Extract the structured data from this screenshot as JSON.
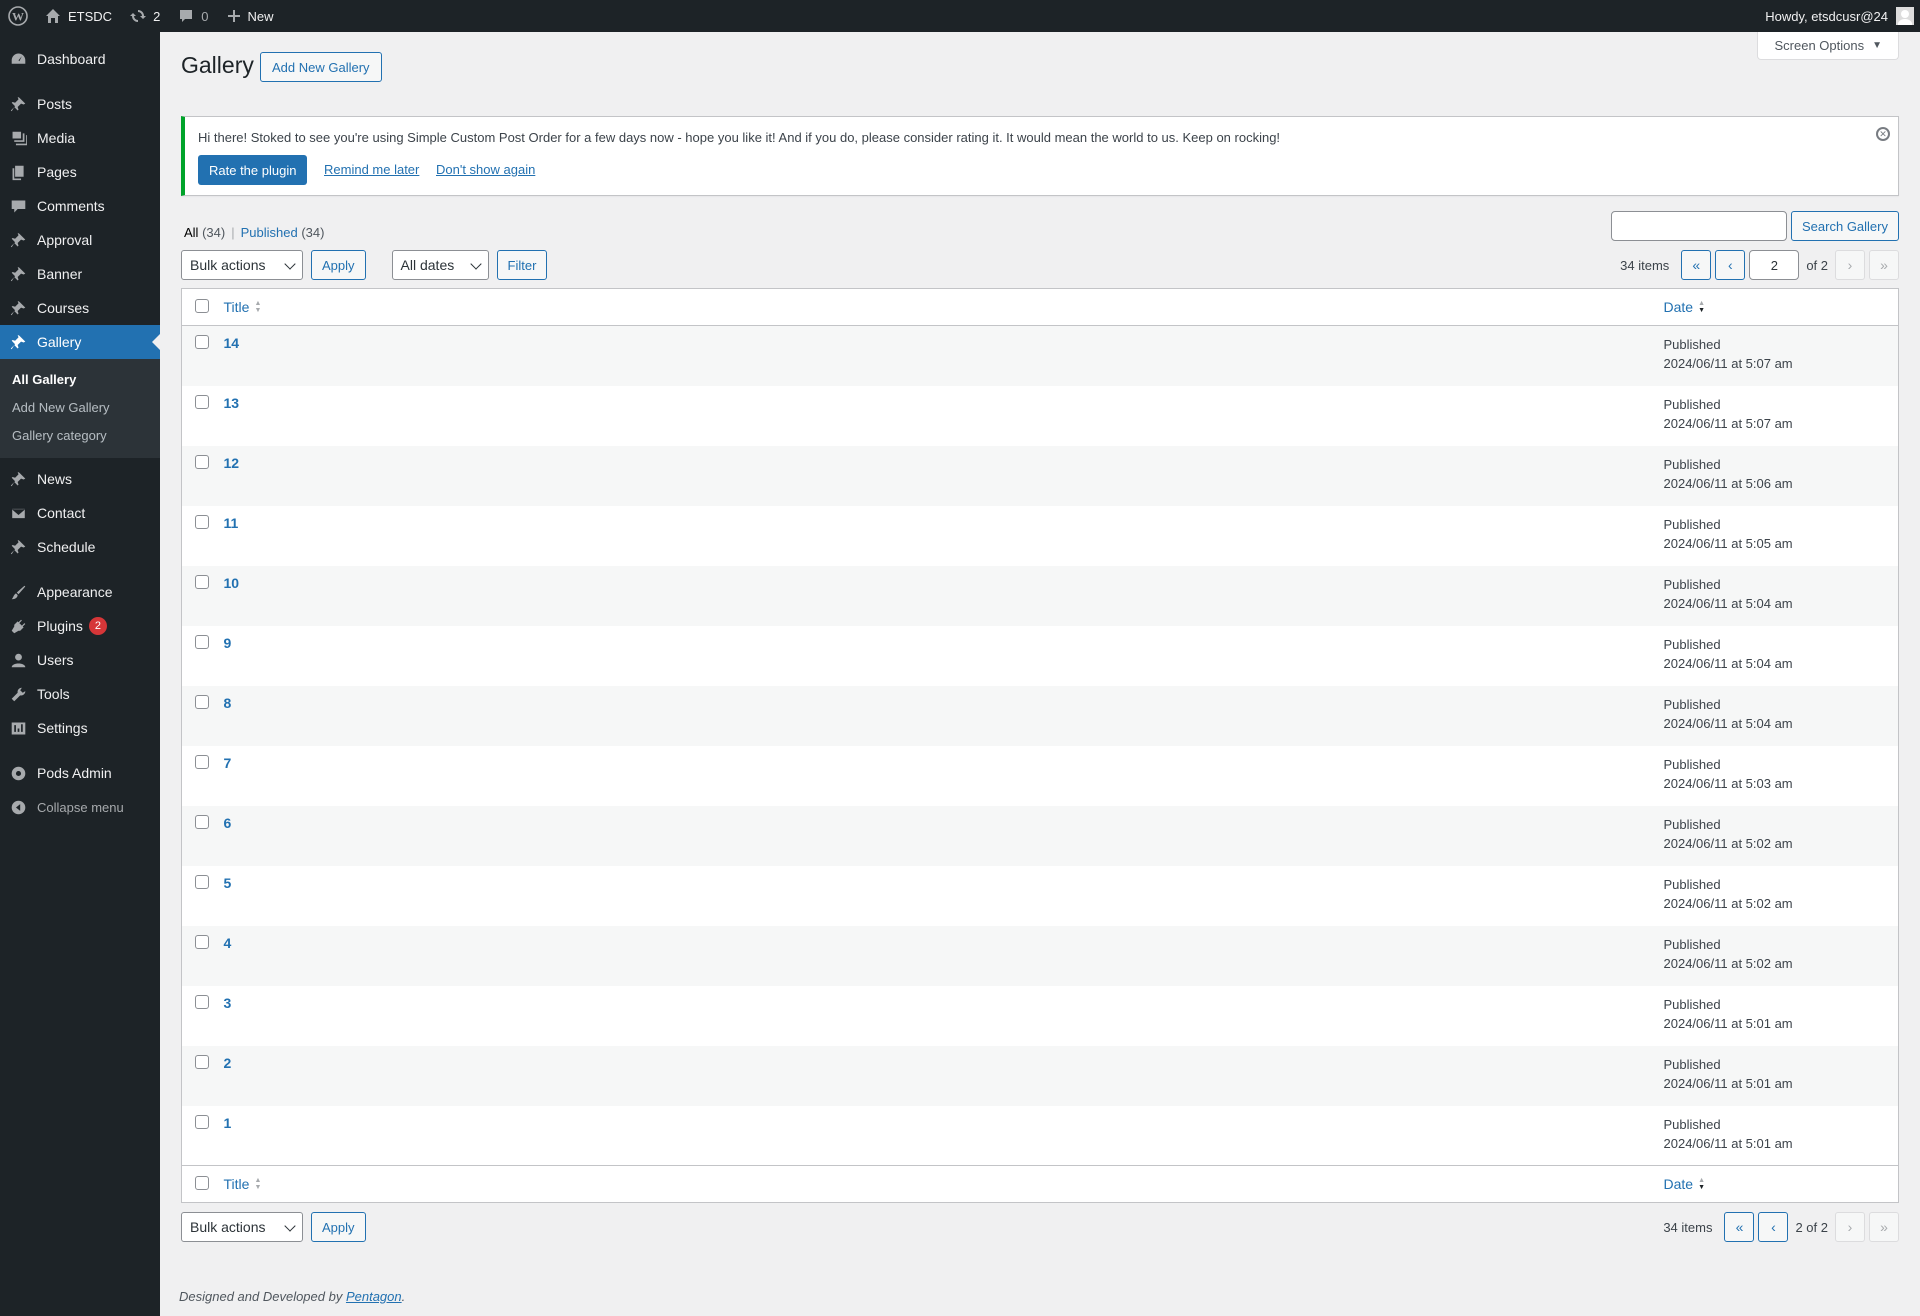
{
  "adminbar": {
    "site_name": "ETSDC",
    "updates_count": "2",
    "comments_count": "0",
    "new_label": "New",
    "howdy": "Howdy, etsdcusr@24"
  },
  "sidebar": {
    "items": [
      {
        "label": "Dashboard",
        "icon": "dashboard-icon"
      },
      {
        "label": "Posts",
        "icon": "pin-icon"
      },
      {
        "label": "Media",
        "icon": "media-icon"
      },
      {
        "label": "Pages",
        "icon": "pages-icon"
      },
      {
        "label": "Comments",
        "icon": "comment-icon"
      },
      {
        "label": "Approval",
        "icon": "pin-icon"
      },
      {
        "label": "Banner",
        "icon": "pin-icon"
      },
      {
        "label": "Courses",
        "icon": "pin-icon"
      },
      {
        "label": "Gallery",
        "icon": "pin-icon"
      },
      {
        "label": "News",
        "icon": "pin-icon"
      },
      {
        "label": "Contact",
        "icon": "mail-icon"
      },
      {
        "label": "Schedule",
        "icon": "pin-icon"
      },
      {
        "label": "Appearance",
        "icon": "brush-icon"
      },
      {
        "label": "Plugins",
        "icon": "plugin-icon",
        "badge": "2"
      },
      {
        "label": "Users",
        "icon": "user-icon"
      },
      {
        "label": "Tools",
        "icon": "wrench-icon"
      },
      {
        "label": "Settings",
        "icon": "settings-icon"
      },
      {
        "label": "Pods Admin",
        "icon": "pods-icon"
      }
    ],
    "submenu": [
      "All Gallery",
      "Add New Gallery",
      "Gallery category"
    ],
    "collapse_label": "Collapse menu"
  },
  "screen_options": "Screen Options",
  "page": {
    "title": "Gallery",
    "add_new": "Add New Gallery"
  },
  "notice": {
    "message": "Hi there! Stoked to see you're using Simple Custom Post Order for a few days now - hope you like it! And if you do, please consider rating it. It would mean the world to us. Keep on rocking!",
    "rate": "Rate the plugin",
    "remind": "Remind me later",
    "dont_show": "Don't show again"
  },
  "views": {
    "all": "All",
    "all_count": "(34)",
    "published": "Published",
    "published_count": "(34)"
  },
  "search_button": "Search Gallery",
  "tablenav_top": {
    "bulk_actions": "Bulk actions",
    "apply": "Apply",
    "dates": "All dates",
    "filter": "Filter",
    "items": "34 items",
    "current_page": "2",
    "of_total": "of 2"
  },
  "tablenav_bottom": {
    "bulk_actions": "Bulk actions",
    "apply": "Apply",
    "items": "34 items",
    "paging_text": "2 of 2"
  },
  "pagination": {
    "first": "«",
    "prev": "‹",
    "next": "›",
    "last": "»"
  },
  "columns": {
    "title": "Title",
    "date": "Date"
  },
  "rows": [
    {
      "title": "14",
      "status": "Published",
      "date": "2024/06/11 at 5:07 am"
    },
    {
      "title": "13",
      "status": "Published",
      "date": "2024/06/11 at 5:07 am"
    },
    {
      "title": "12",
      "status": "Published",
      "date": "2024/06/11 at 5:06 am"
    },
    {
      "title": "11",
      "status": "Published",
      "date": "2024/06/11 at 5:05 am"
    },
    {
      "title": "10",
      "status": "Published",
      "date": "2024/06/11 at 5:04 am"
    },
    {
      "title": "9",
      "status": "Published",
      "date": "2024/06/11 at 5:04 am"
    },
    {
      "title": "8",
      "status": "Published",
      "date": "2024/06/11 at 5:04 am"
    },
    {
      "title": "7",
      "status": "Published",
      "date": "2024/06/11 at 5:03 am"
    },
    {
      "title": "6",
      "status": "Published",
      "date": "2024/06/11 at 5:02 am"
    },
    {
      "title": "5",
      "status": "Published",
      "date": "2024/06/11 at 5:02 am"
    },
    {
      "title": "4",
      "status": "Published",
      "date": "2024/06/11 at 5:02 am"
    },
    {
      "title": "3",
      "status": "Published",
      "date": "2024/06/11 at 5:01 am"
    },
    {
      "title": "2",
      "status": "Published",
      "date": "2024/06/11 at 5:01 am"
    },
    {
      "title": "1",
      "status": "Published",
      "date": "2024/06/11 at 5:01 am"
    }
  ],
  "footer": {
    "text": "Designed and Developed by ",
    "link": "Pentagon",
    "period": "."
  },
  "colors": {
    "accent": "#2271b1",
    "sidebar_bg": "#1d2327",
    "notice_border": "#00a32a",
    "badge": "#d63638"
  }
}
